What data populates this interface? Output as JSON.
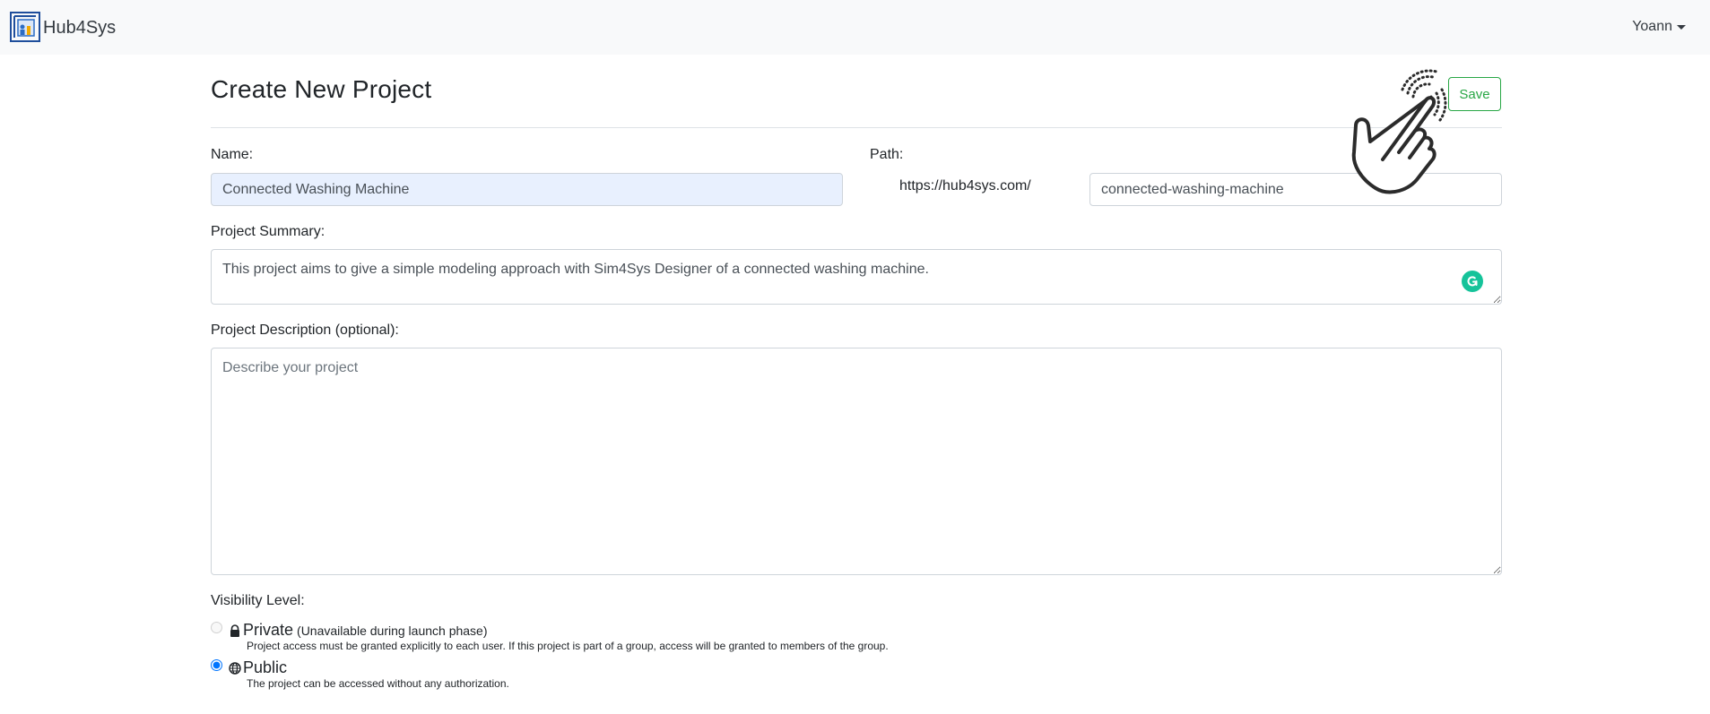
{
  "navbar": {
    "brand": "Hub4Sys",
    "user": "Yoann"
  },
  "page": {
    "title": "Create New Project",
    "save_label": "Save"
  },
  "form": {
    "name_label": "Name:",
    "name_value": "Connected Washing Machine",
    "path_label": "Path:",
    "path_prefix": "https://hub4sys.com/",
    "path_value": "connected-washing-machine",
    "summary_label": "Project Summary:",
    "summary_value": "This project aims to give a simple modeling approach with Sim4Sys Designer of a connected washing machine.",
    "description_label": "Project Description (optional):",
    "description_placeholder": "Describe your project",
    "visibility_label": "Visibility Level:",
    "visibility_options": [
      {
        "title": "Private",
        "note": "(Unavailable during launch phase)",
        "description": "Project access must be granted explicitly to each user. If this project is part of a group, access will be granted to members of the group.",
        "icon": "lock-icon",
        "selected": false,
        "disabled": true
      },
      {
        "title": "Public",
        "note": "",
        "description": "The project can be accessed without any authorization.",
        "icon": "globe-icon",
        "selected": true,
        "disabled": false
      }
    ]
  },
  "colors": {
    "save_accent": "#28a745",
    "navbar_bg": "#f8f9fa",
    "autofill_bg": "#e8f0fe",
    "grammarly": "#15c39a",
    "radio_selected": "#0d6efd"
  }
}
